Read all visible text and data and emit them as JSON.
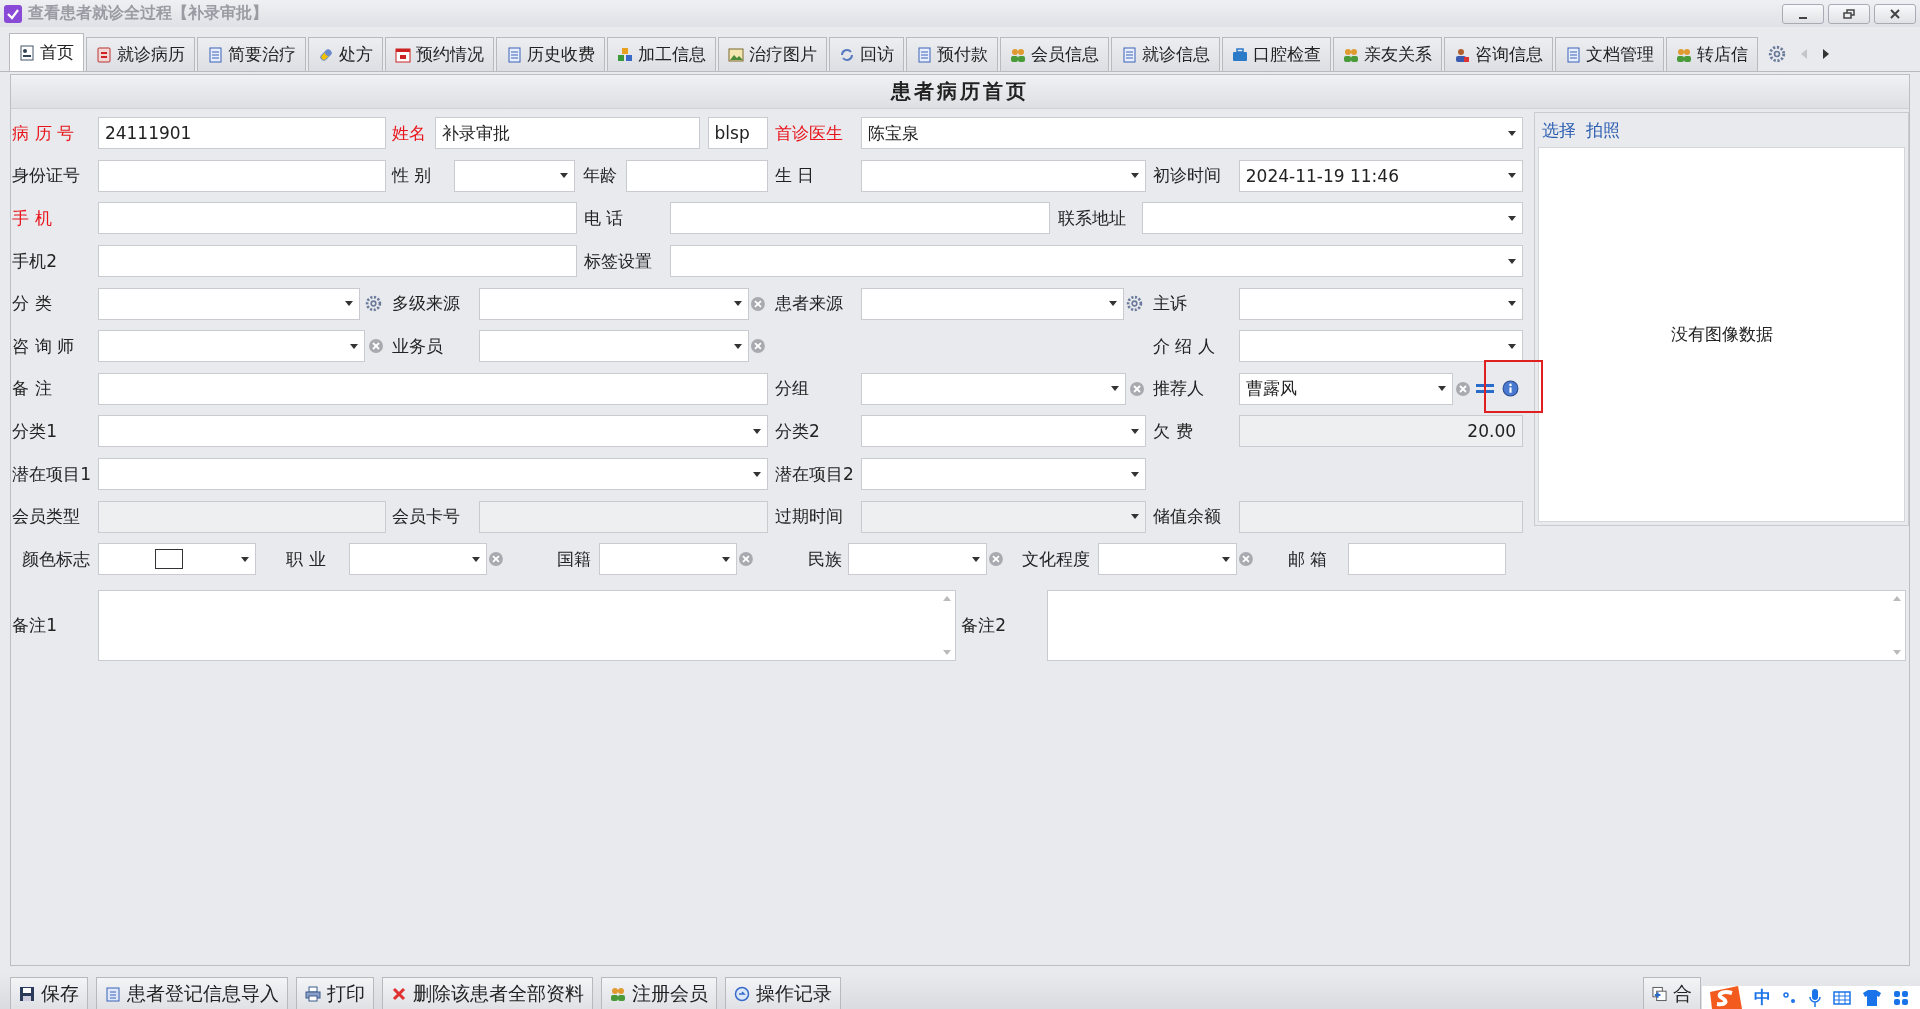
{
  "window": {
    "title": "查看患者就诊全过程【补录审批】"
  },
  "tabs": [
    {
      "label": "首页",
      "selected": true
    },
    {
      "label": "就诊病历",
      "selected": false
    },
    {
      "label": "简要治疗",
      "selected": false
    },
    {
      "label": "处方",
      "selected": false
    },
    {
      "label": "预约情况",
      "selected": false
    },
    {
      "label": "历史收费",
      "selected": false
    },
    {
      "label": "加工信息",
      "selected": false
    },
    {
      "label": "治疗图片",
      "selected": false
    },
    {
      "label": "回访",
      "selected": false
    },
    {
      "label": "预付款",
      "selected": false
    },
    {
      "label": "会员信息",
      "selected": false
    },
    {
      "label": "就诊信息",
      "selected": false
    },
    {
      "label": "口腔检查",
      "selected": false
    },
    {
      "label": "亲友关系",
      "selected": false
    },
    {
      "label": "咨询信息",
      "selected": false
    },
    {
      "label": "文档管理",
      "selected": false
    },
    {
      "label": "转店信",
      "selected": false
    }
  ],
  "panel_title": "患者病历首页",
  "form": {
    "rows": [
      {
        "items": [
          {
            "kind": "label",
            "text": "病 历 号",
            "required": true
          },
          {
            "kind": "text",
            "value": "24111901",
            "disabled": false
          },
          {
            "kind": "label",
            "text": "姓名",
            "required": true
          },
          {
            "kind": "text",
            "value": "补录审批",
            "disabled": false
          },
          {
            "kind": "text",
            "value": "blsp",
            "disabled": false
          },
          {
            "kind": "label",
            "text": "首诊医生",
            "required": true
          },
          {
            "kind": "dropdown",
            "value": "陈宝泉",
            "disabled": false
          }
        ]
      },
      {
        "items": [
          {
            "kind": "label",
            "text": "身份证号",
            "required": false
          },
          {
            "kind": "text",
            "disabled": false
          },
          {
            "kind": "label",
            "text": "性 别",
            "required": false
          },
          {
            "kind": "dropdown",
            "disabled": false
          },
          {
            "kind": "label",
            "text": "年龄",
            "required": false
          },
          {
            "kind": "text",
            "disabled": false
          },
          {
            "kind": "label",
            "text": "生 日",
            "required": false
          },
          {
            "kind": "dropdown",
            "disabled": false
          },
          {
            "kind": "label",
            "text": "初诊时间",
            "required": false
          },
          {
            "kind": "dropdown",
            "value": "2024-11-19 11:46",
            "disabled": false
          }
        ]
      },
      {
        "items": [
          {
            "kind": "label",
            "text": "手 机",
            "required": true
          },
          {
            "kind": "text",
            "disabled": false
          },
          {
            "kind": "label",
            "text": "电 话",
            "required": false
          },
          {
            "kind": "text",
            "disabled": false
          },
          {
            "kind": "label",
            "text": "联系地址",
            "required": false
          },
          {
            "kind": "dropdown",
            "disabled": false
          }
        ]
      },
      {
        "items": [
          {
            "kind": "label",
            "text": "手机2",
            "required": false
          },
          {
            "kind": "text",
            "disabled": false
          },
          {
            "kind": "label",
            "text": "标签设置",
            "required": false
          },
          {
            "kind": "dropdown",
            "disabled": false
          }
        ]
      },
      {
        "items": [
          {
            "kind": "label",
            "text": "分 类",
            "required": false
          },
          {
            "kind": "dropdown",
            "disabled": false
          },
          {
            "kind": "label",
            "text": "多级来源",
            "required": false
          },
          {
            "kind": "dropdown",
            "disabled": false
          },
          {
            "kind": "label",
            "text": "患者来源",
            "required": false
          },
          {
            "kind": "dropdown",
            "disabled": false
          },
          {
            "kind": "label",
            "text": "主诉",
            "required": false
          },
          {
            "kind": "dropdown",
            "disabled": false
          }
        ]
      },
      {
        "items": [
          {
            "kind": "label",
            "text": "咨 询 师",
            "required": false
          },
          {
            "kind": "dropdown",
            "disabled": false
          },
          {
            "kind": "label",
            "text": "业务员",
            "required": false
          },
          {
            "kind": "dropdown",
            "disabled": false
          },
          {
            "kind": "label",
            "text": "介 绍 人",
            "required": false
          },
          {
            "kind": "dropdown",
            "disabled": false
          }
        ]
      },
      {
        "items": [
          {
            "kind": "label",
            "text": "备 注",
            "required": false
          },
          {
            "kind": "text",
            "disabled": false
          },
          {
            "kind": "label",
            "text": "分组",
            "required": false
          },
          {
            "kind": "dropdown",
            "disabled": false
          },
          {
            "kind": "label",
            "text": "推荐人",
            "required": false
          },
          {
            "kind": "dropdown",
            "value": "曹露风",
            "disabled": false
          }
        ]
      },
      {
        "items": [
          {
            "kind": "label",
            "text": "分类1",
            "required": false
          },
          {
            "kind": "dropdown",
            "disabled": false
          },
          {
            "kind": "label",
            "text": "分类2",
            "required": false
          },
          {
            "kind": "dropdown",
            "disabled": false
          },
          {
            "kind": "label",
            "text": "欠 费",
            "required": false
          },
          {
            "kind": "number",
            "value": "20.00",
            "disabled": true
          }
        ]
      },
      {
        "items": [
          {
            "kind": "label",
            "text": "潜在项目1",
            "required": false
          },
          {
            "kind": "dropdown",
            "disabled": false
          },
          {
            "kind": "label",
            "text": "潜在项目2",
            "required": false
          },
          {
            "kind": "dropdown",
            "disabled": false
          }
        ]
      },
      {
        "items": [
          {
            "kind": "label",
            "text": "会员类型",
            "required": false
          },
          {
            "kind": "text",
            "disabled": true
          },
          {
            "kind": "label",
            "text": "会员卡号",
            "required": false
          },
          {
            "kind": "text",
            "disabled": true
          },
          {
            "kind": "label",
            "text": "过期时间",
            "required": false
          },
          {
            "kind": "dropdown",
            "disabled": true
          },
          {
            "kind": "label",
            "text": "储值余额",
            "required": false
          },
          {
            "kind": "text",
            "disabled": true
          }
        ]
      },
      {
        "items": [
          {
            "kind": "label",
            "text": "颜色标志",
            "required": false
          },
          {
            "kind": "color",
            "disabled": false
          },
          {
            "kind": "label",
            "text": "职 业",
            "required": false
          },
          {
            "kind": "dropdown",
            "disabled": false
          },
          {
            "kind": "label",
            "text": "国籍",
            "required": false
          },
          {
            "kind": "dropdown",
            "disabled": false
          },
          {
            "kind": "label",
            "text": "民族",
            "required": false
          },
          {
            "kind": "dropdown",
            "disabled": false
          },
          {
            "kind": "label",
            "text": "文化程度",
            "required": false
          },
          {
            "kind": "dropdown",
            "disabled": false
          },
          {
            "kind": "label",
            "text": "邮 箱",
            "required": false
          },
          {
            "kind": "text",
            "disabled": false
          }
        ]
      },
      {
        "items": [
          {
            "kind": "label",
            "text": "备注1",
            "required": false
          },
          {
            "kind": "textarea",
            "disabled": false
          },
          {
            "kind": "label",
            "text": "备注2",
            "required": false
          },
          {
            "kind": "textarea",
            "disabled": false
          }
        ]
      }
    ]
  },
  "photo_panel": {
    "links": [
      "选择",
      "拍照"
    ],
    "empty_text": "没有图像数据"
  },
  "annotation": {
    "kind": "highlight-box"
  },
  "toolbar": {
    "buttons": [
      {
        "kind": "save",
        "label": "保存"
      },
      {
        "kind": "import",
        "label": "患者登记信息导入"
      },
      {
        "kind": "print",
        "label": "打印"
      },
      {
        "kind": "delete",
        "label": "删除该患者全部资料"
      },
      {
        "kind": "member",
        "label": "注册会员"
      },
      {
        "kind": "log",
        "label": "操作记录"
      }
    ],
    "right_buttons": [
      {
        "kind": "merge",
        "label": "合"
      }
    ]
  },
  "ime_bar": {
    "mode": "中"
  }
}
